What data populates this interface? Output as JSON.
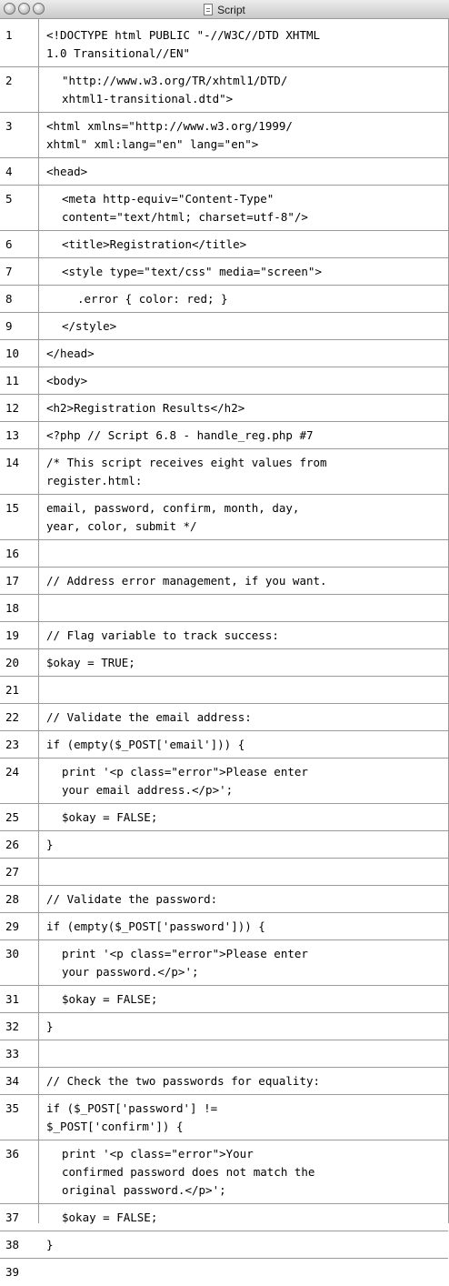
{
  "window": {
    "title": "Script"
  },
  "lines": [
    {
      "n": "1",
      "text": [
        "<!DOCTYPE html PUBLIC \"-//W3C//DTD XHTML",
        "1.0 Transitional//EN\""
      ],
      "indent": 0
    },
    {
      "n": "2",
      "text": [
        "\"http://www.w3.org/TR/xhtml1/DTD/",
        "xhtml1-transitional.dtd\">"
      ],
      "indent": 1
    },
    {
      "n": "3",
      "text": [
        "<html xmlns=\"http://www.w3.org/1999/",
        "xhtml\" xml:lang=\"en\" lang=\"en\">"
      ],
      "indent": 0
    },
    {
      "n": "4",
      "text": [
        "<head>"
      ],
      "indent": 0
    },
    {
      "n": "5",
      "text": [
        "<meta http-equiv=\"Content-Type\"",
        "content=\"text/html; charset=utf-8\"/>"
      ],
      "indent": 1
    },
    {
      "n": "6",
      "text": [
        "<title>Registration</title>"
      ],
      "indent": 1
    },
    {
      "n": "7",
      "text": [
        "<style type=\"text/css\" media=\"screen\">"
      ],
      "indent": 1
    },
    {
      "n": "8",
      "text": [
        ".error { color: red; }"
      ],
      "indent": 2
    },
    {
      "n": "9",
      "text": [
        "</style>"
      ],
      "indent": 1
    },
    {
      "n": "10",
      "text": [
        "</head>"
      ],
      "indent": 0
    },
    {
      "n": "11",
      "text": [
        "<body>"
      ],
      "indent": 0
    },
    {
      "n": "12",
      "text": [
        "<h2>Registration Results</h2>"
      ],
      "indent": 0
    },
    {
      "n": "13",
      "text": [
        "<?php // Script 6.8 - handle_reg.php #7"
      ],
      "indent": 0
    },
    {
      "n": "14",
      "text": [
        "/* This script receives eight values from",
        "register.html:"
      ],
      "indent": 0
    },
    {
      "n": "15",
      "text": [
        "email, password, confirm, month, day,",
        "year, color, submit */"
      ],
      "indent": 0
    },
    {
      "n": "16",
      "text": [
        ""
      ],
      "indent": 0
    },
    {
      "n": "17",
      "text": [
        "// Address error management, if you want."
      ],
      "indent": 0
    },
    {
      "n": "18",
      "text": [
        ""
      ],
      "indent": 0
    },
    {
      "n": "19",
      "text": [
        "// Flag variable to track success:"
      ],
      "indent": 0
    },
    {
      "n": "20",
      "text": [
        "$okay = TRUE;"
      ],
      "indent": 0
    },
    {
      "n": "21",
      "text": [
        ""
      ],
      "indent": 0
    },
    {
      "n": "22",
      "text": [
        "// Validate the email address:"
      ],
      "indent": 0
    },
    {
      "n": "23",
      "text": [
        "if (empty($_POST['email'])) {"
      ],
      "indent": 0
    },
    {
      "n": "24",
      "text": [
        "print '<p class=\"error\">Please enter",
        "your email address.</p>';"
      ],
      "indent": 1
    },
    {
      "n": "25",
      "text": [
        "$okay = FALSE;"
      ],
      "indent": 1
    },
    {
      "n": "26",
      "text": [
        "}"
      ],
      "indent": 0
    },
    {
      "n": "27",
      "text": [
        ""
      ],
      "indent": 0
    },
    {
      "n": "28",
      "text": [
        "// Validate the password:"
      ],
      "indent": 0
    },
    {
      "n": "29",
      "text": [
        "if (empty($_POST['password'])) {"
      ],
      "indent": 0
    },
    {
      "n": "30",
      "text": [
        "print '<p class=\"error\">Please enter",
        "your password.</p>';"
      ],
      "indent": 1
    },
    {
      "n": "31",
      "text": [
        "$okay = FALSE;"
      ],
      "indent": 1
    },
    {
      "n": "32",
      "text": [
        "}"
      ],
      "indent": 0
    },
    {
      "n": "33",
      "text": [
        ""
      ],
      "indent": 0
    },
    {
      "n": "34",
      "text": [
        "// Check the two passwords for equality:"
      ],
      "indent": 0
    },
    {
      "n": "35",
      "text": [
        "if ($_POST['password'] !=",
        "$_POST['confirm']) {"
      ],
      "indent": 0
    },
    {
      "n": "36",
      "text": [
        "print '<p class=\"error\">Your",
        "confirmed password does not match the",
        "original password.</p>';"
      ],
      "indent": 1
    },
    {
      "n": "37",
      "text": [
        "$okay = FALSE;"
      ],
      "indent": 1
    },
    {
      "n": "38",
      "text": [
        "}"
      ],
      "indent": 0
    },
    {
      "n": "39",
      "text": [
        ""
      ],
      "indent": 0
    }
  ]
}
